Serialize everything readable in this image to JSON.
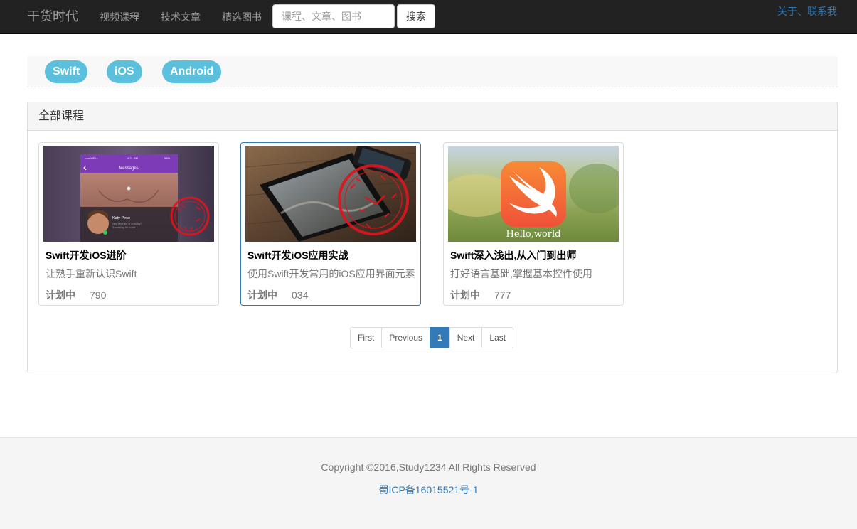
{
  "navbar": {
    "brand": "干货时代",
    "links": [
      "视频课程",
      "技术文章",
      "精选图书"
    ],
    "search_placeholder": "课程、文章、图书",
    "search_button": "搜索",
    "about": "关于、联系我"
  },
  "tags": [
    "Swift",
    "iOS",
    "Android"
  ],
  "panel": {
    "heading": "全部课程",
    "courses": [
      {
        "title": "Swift开发iOS进阶",
        "desc": "让熟手重新认识Swift",
        "status": "计划中",
        "count": "790",
        "thumb": {
          "status_bar_carrier": "••oo WELL",
          "status_bar_time": "4:21 PM",
          "status_bar_battery": "55%",
          "nav_title": "Messages",
          "contact_name": "Katy Pirce",
          "message_line_1": "Hey, what are of so today?",
          "message_line_2": "Something I'm bored"
        }
      },
      {
        "title": "Swift开发iOS应用实战",
        "desc": "使用Swift开发常用的iOS应用界面元素",
        "status": "计划中",
        "count": "034"
      },
      {
        "title": "Swift深入浅出,从入门到出师",
        "desc": "打好语言基础,掌握基本控件使用",
        "status": "计划中",
        "count": "777",
        "thumb": {
          "caption": "Hello,world"
        }
      }
    ]
  },
  "pagination": [
    "First",
    "Previous",
    "1",
    "Next",
    "Last"
  ],
  "pagination_active": "1",
  "footer": {
    "copyright": "Copyright ©2016,Study1234 All Rights Reserved",
    "icp": "蜀ICP备16015521号-1"
  },
  "colors": {
    "navbar_bg": "#222222",
    "tag_bg": "#5bc0de",
    "link": "#337ab7",
    "stamp_red": "#e0141e",
    "swift_orange": "#f05138"
  }
}
